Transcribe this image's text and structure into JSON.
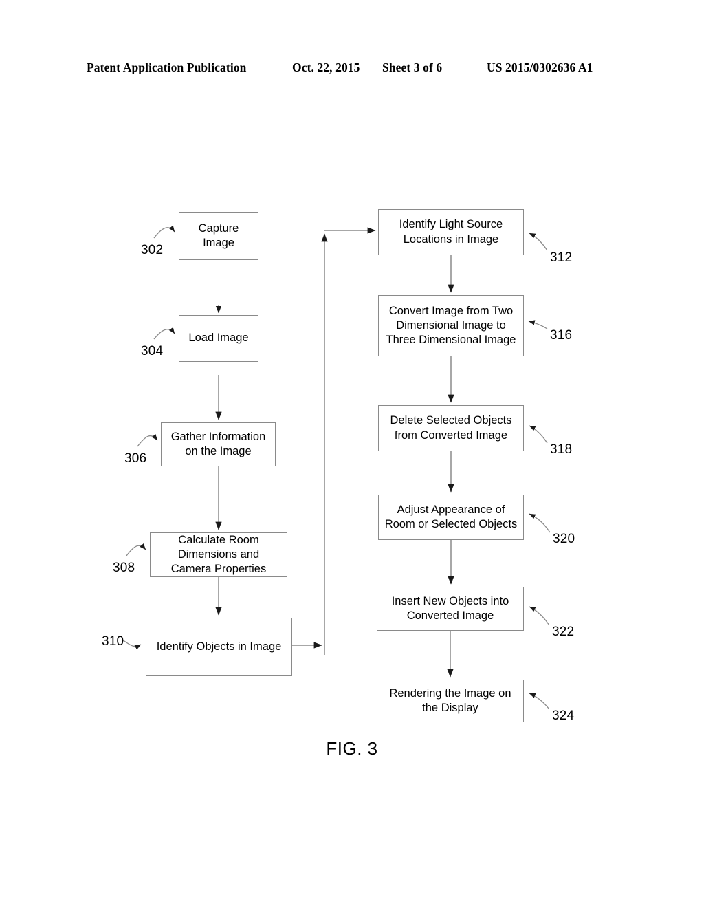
{
  "header": {
    "publication": "Patent Application Publication",
    "date": "Oct. 22, 2015",
    "sheet": "Sheet 3 of 6",
    "number": "US 2015/0302636 A1"
  },
  "figure": {
    "caption": "FIG. 3",
    "line_color": "#8a8a8a",
    "text_color": "#000000",
    "nodes": [
      {
        "ref": "302",
        "label": "Capture Image",
        "line1": "Capture",
        "line2": "Image",
        "line3": ""
      },
      {
        "ref": "304",
        "label": "Load Image",
        "line1": "Load Image",
        "line2": "",
        "line3": ""
      },
      {
        "ref": "306",
        "label": "Gather Information on the Image",
        "line1": "Gather Information",
        "line2": "on the Image",
        "line3": ""
      },
      {
        "ref": "308",
        "label": "Calculate Room Dimensions and Camera Properties",
        "line1": "Calculate Room",
        "line2": "Dimensions and",
        "line3": "Camera Properties"
      },
      {
        "ref": "310",
        "label": "Identify Objects in Image",
        "line1": "Identify Objects in Image",
        "line2": "",
        "line3": ""
      },
      {
        "ref": "312",
        "label": "Identify Light Source Locations in Image",
        "line1": "Identify Light Source",
        "line2": "Locations in Image",
        "line3": ""
      },
      {
        "ref": "316",
        "label": "Convert Image from Two Dimensional Image to Three Dimensional Image",
        "line1": "Convert Image from Two",
        "line2": "Dimensional Image to",
        "line3": "Three Dimensional Image"
      },
      {
        "ref": "318",
        "label": "Delete Selected Objects from Converted Image",
        "line1": "Delete Selected Objects",
        "line2": "from Converted Image",
        "line3": ""
      },
      {
        "ref": "320",
        "label": "Adjust Appearance of Room or Selected Objects",
        "line1": "Adjust Appearance of",
        "line2": "Room or Selected Objects",
        "line3": ""
      },
      {
        "ref": "322",
        "label": "Insert New Objects into Converted Image",
        "line1": "Insert New Objects into",
        "line2": "Converted Image",
        "line3": ""
      },
      {
        "ref": "324",
        "label": "Rendering the Image on the Display",
        "line1": "Rendering the Image on",
        "line2": "the Display",
        "line3": ""
      }
    ],
    "flow": [
      "302 -> 304",
      "304 -> 306",
      "306 -> 308",
      "308 -> 310",
      "310 -> 312",
      "312 -> 316",
      "316 -> 318",
      "318 -> 320",
      "320 -> 322",
      "322 -> 324"
    ]
  }
}
